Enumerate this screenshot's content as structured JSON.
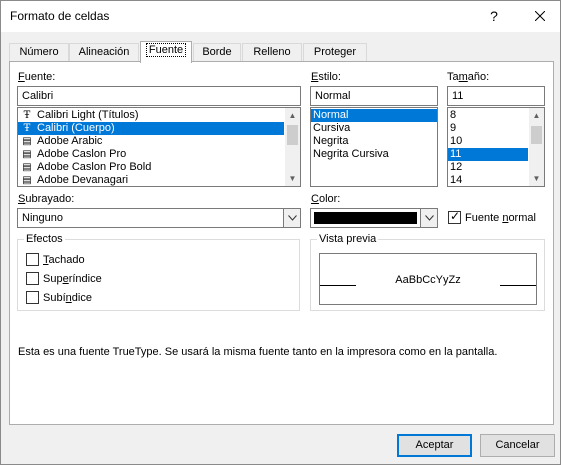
{
  "window": {
    "title": "Formato de celdas",
    "help": "?",
    "close": "✕"
  },
  "tabs": [
    {
      "label": "Número"
    },
    {
      "label": "Alineación"
    },
    {
      "label": "Fuente"
    },
    {
      "label": "Borde"
    },
    {
      "label": "Relleno"
    },
    {
      "label": "Proteger"
    }
  ],
  "font": {
    "label": "Fuente:",
    "value": "Calibri",
    "list": [
      "Calibri Light (Títulos)",
      "Calibri (Cuerpo)",
      "Adobe Arabic",
      "Adobe Caslon Pro",
      "Adobe Caslon Pro Bold",
      "Adobe Devanagari"
    ],
    "selected_index": 1
  },
  "style": {
    "label": "Estilo:",
    "value": "Normal",
    "list": [
      "Normal",
      "Cursiva",
      "Negrita",
      "Negrita Cursiva"
    ],
    "selected_index": 0
  },
  "size": {
    "label": "Tamaño:",
    "value": "11",
    "list": [
      "8",
      "9",
      "10",
      "11",
      "12",
      "14"
    ],
    "selected_index": 3
  },
  "underline": {
    "label": "Subrayado:",
    "value": "Ninguno"
  },
  "color": {
    "label": "Color:",
    "swatch": "#000000"
  },
  "normal_font": {
    "label": "Fuente normal",
    "checked": true
  },
  "effects": {
    "title": "Efectos",
    "items": [
      {
        "label": "Tachado",
        "checked": false
      },
      {
        "label": "Superíndice",
        "checked": false
      },
      {
        "label": "Subíndice",
        "checked": false
      }
    ]
  },
  "preview": {
    "title": "Vista previa",
    "sample": "AaBbCcYyZz"
  },
  "info_text": "Esta es una fuente TrueType. Se usará la misma fuente tanto en la impresora como en la pantalla.",
  "buttons": {
    "accept": "Aceptar",
    "cancel": "Cancelar"
  },
  "colors": {
    "selection": "#0078d7",
    "accent": "#0078d7"
  }
}
